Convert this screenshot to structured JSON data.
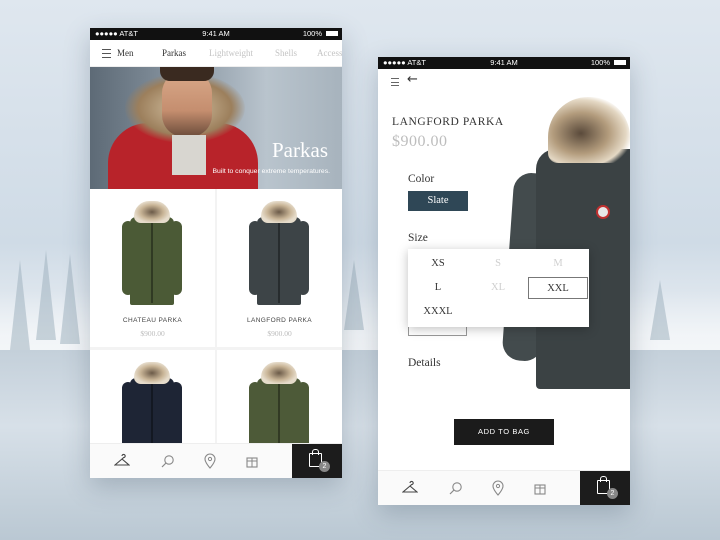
{
  "status_bar": {
    "carrier": "●●●●● AT&T",
    "time": "9:41 AM",
    "battery": "100%"
  },
  "list_screen": {
    "nav": {
      "menu_label": "Men",
      "tabs": [
        "Parkas",
        "Lightweight",
        "Shells",
        "Access"
      ],
      "active_tab": "Parkas"
    },
    "hero": {
      "title": "Parkas",
      "subtitle": "Built to conquer extreme temperatures."
    },
    "products": [
      {
        "name": "CHATEAU PARKA",
        "price": "$900.00",
        "color": "#4b5a36"
      },
      {
        "name": "LANGFORD PARKA",
        "price": "$900.00",
        "color": "#3d4447"
      },
      {
        "name": "",
        "price": "",
        "color": "#1e2535"
      },
      {
        "name": "",
        "price": "",
        "color": "#4d5a38"
      }
    ],
    "tabbar": {
      "icons": [
        "hanger-icon",
        "search-icon",
        "location-icon",
        "gift-icon",
        "bag-icon"
      ],
      "cart_count": "2"
    }
  },
  "detail_screen": {
    "title": "LANGFORD PARKA",
    "price": "$900.00",
    "color_label": "Color",
    "selected_color": "Slate",
    "size_label": "Size",
    "sizes": [
      {
        "label": "XS",
        "available": true,
        "selected": false
      },
      {
        "label": "S",
        "available": false,
        "selected": false
      },
      {
        "label": "M",
        "available": false,
        "selected": false
      },
      {
        "label": "L",
        "available": true,
        "selected": false
      },
      {
        "label": "XL",
        "available": false,
        "selected": false
      },
      {
        "label": "XXL",
        "available": true,
        "selected": true
      },
      {
        "label": "XXXL",
        "available": true,
        "selected": false
      }
    ],
    "details_label": "Details",
    "add_to_bag": "ADD TO BAG",
    "cart_count": "2"
  },
  "colors": {
    "accent_dark": "#1c1c1c",
    "slate": "#2f4756",
    "price_grey": "#bdbdbd"
  }
}
